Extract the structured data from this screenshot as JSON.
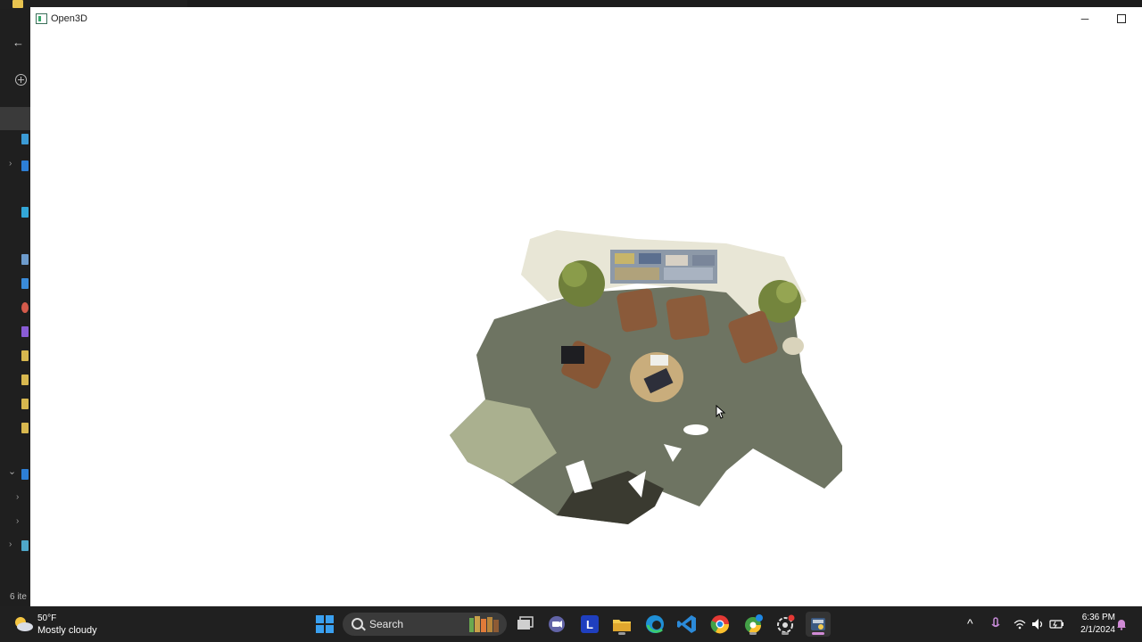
{
  "background_explorer": {
    "items_count_label": "6 ite"
  },
  "open3d_window": {
    "title": "Open3D",
    "minimize_label": "─",
    "scene": "3D reconstructed room point cloud (lobby with armchairs, plants and round table)"
  },
  "taskbar": {
    "weather": {
      "temperature": "50°F",
      "condition": "Mostly cloudy"
    },
    "search_label": "Search",
    "apps": [
      "start",
      "search",
      "task-view",
      "teams",
      "l-app",
      "file-explorer",
      "edge",
      "vscode",
      "chrome",
      "chrome-beta",
      "settings-app",
      "python-app"
    ],
    "tray": {
      "chevron": "^"
    },
    "clock": {
      "time": "6:36 PM",
      "date": "2/1/2024"
    }
  },
  "colors": {
    "taskbar_bg": "#202020",
    "window_bg": "#ffffff",
    "accent": "#d08ad5"
  }
}
